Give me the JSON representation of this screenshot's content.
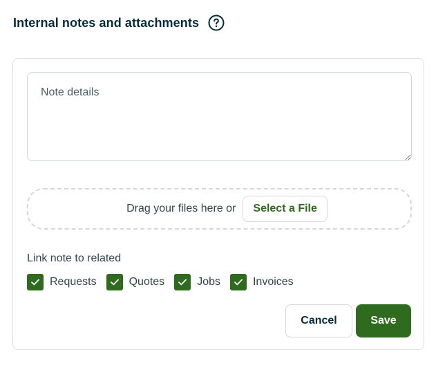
{
  "header": {
    "title": "Internal notes and attachments",
    "help_icon": "question-circle-icon"
  },
  "note": {
    "placeholder": "Note details",
    "value": ""
  },
  "dropzone": {
    "text": "Drag your files here or",
    "select_label": "Select a File"
  },
  "link": {
    "label": "Link note to related",
    "items": [
      {
        "label": "Requests",
        "checked": true
      },
      {
        "label": "Quotes",
        "checked": true
      },
      {
        "label": "Jobs",
        "checked": true
      },
      {
        "label": "Invoices",
        "checked": true
      }
    ]
  },
  "actions": {
    "cancel_label": "Cancel",
    "save_label": "Save"
  },
  "colors": {
    "primary_green": "#2e6b1f",
    "heading": "#032b3a",
    "border": "#d4d8da"
  }
}
